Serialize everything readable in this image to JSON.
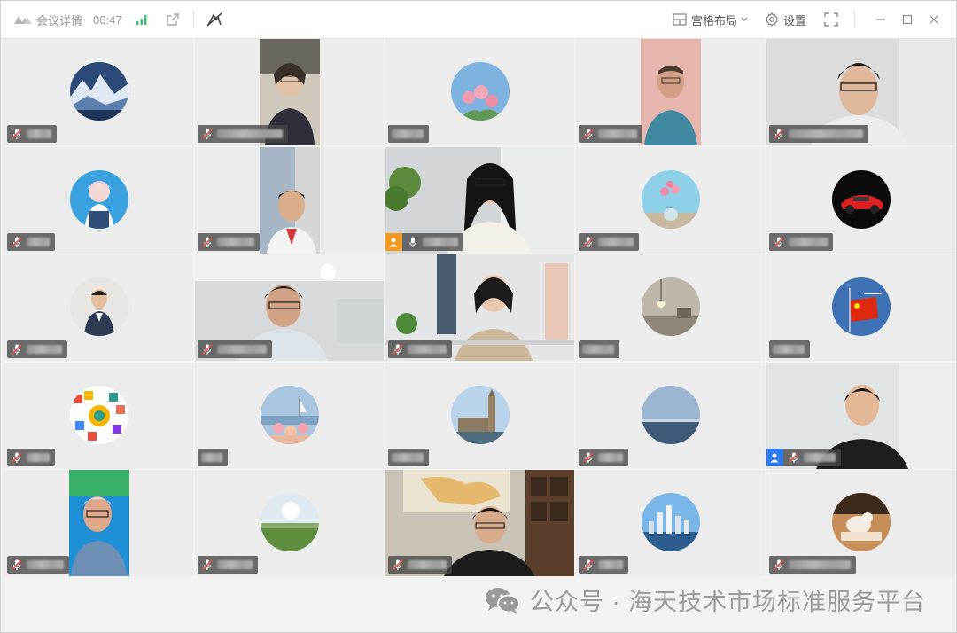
{
  "titlebar": {
    "meeting_details": "会议详情",
    "duration": "00:47",
    "layout_label": "宫格布局",
    "settings_label": "设置"
  },
  "colors": {
    "muted_mic": "#e2534c",
    "host_orange": "#f39a1e",
    "cohost_blue": "#2f7bf0",
    "signal_green": "#35c46b"
  },
  "watermark": {
    "text": "公众号 · 海天技术市场标准服务平台"
  }
}
